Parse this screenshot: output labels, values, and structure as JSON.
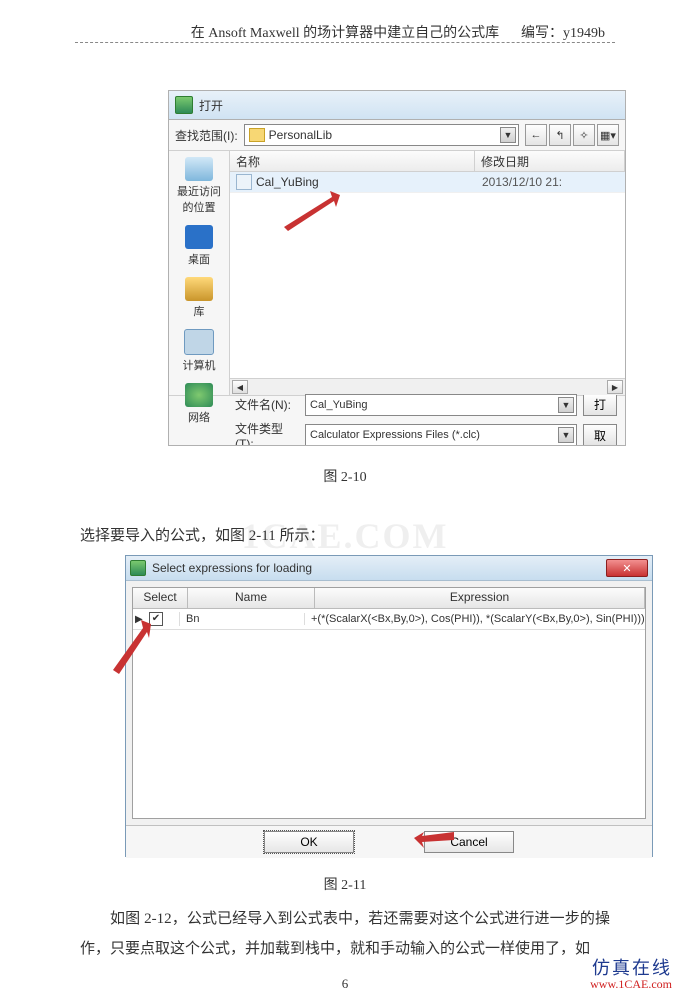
{
  "header": {
    "title": "在 Ansoft Maxwell 的场计算器中建立自己的公式库",
    "author_label": "编写：y1949b"
  },
  "figure1": {
    "dialog_title": "打开",
    "lookin_label": "查找范围(I):",
    "lookin_value": "PersonalLib",
    "nav_back": "←",
    "nav_up": "↰",
    "nav_newfolder": "✧",
    "nav_viewmenu": "▦▾",
    "places": {
      "recent": "最近访问的位置",
      "desktop": "桌面",
      "library": "库",
      "computer": "计算机",
      "network": "网络"
    },
    "columns": {
      "name": "名称",
      "date": "修改日期"
    },
    "file": {
      "name": "Cal_YuBing",
      "date": "2013/12/10 21:"
    },
    "filename_label": "文件名(N):",
    "filename_value": "Cal_YuBing",
    "filetype_label": "文件类型(T):",
    "filetype_value": "Calculator Expressions Files (*.clc)",
    "btn_open": "打",
    "btn_cancel": "取"
  },
  "caption1": "图 2-10",
  "para1": "选择要导入的公式，如图 2-11 所示：",
  "figure2": {
    "dialog_title": "Select expressions for loading",
    "close_glyph": "✕",
    "columns": {
      "select": "Select",
      "name": "Name",
      "expression": "Expression"
    },
    "row": {
      "checked": true,
      "name": "Bn",
      "expression": "+(*(ScalarX(<Bx,By,0>), Cos(PHI)), *(ScalarY(<Bx,By,0>), Sin(PHI)))"
    },
    "btn_ok": "OK",
    "btn_cancel": "Cancel"
  },
  "caption2": "图 2-11",
  "para2": "如图 2-12，公式已经导入到公式表中，若还需要对这个公式进行进一步的操作，只要点取这个公式，并加载到栈中，就和手动输入的公式一样使用了，如",
  "page_number": "6",
  "watermark": "1CAE.COM",
  "footer": {
    "cn": "仿真在线",
    "en": "www.1CAE.com"
  }
}
